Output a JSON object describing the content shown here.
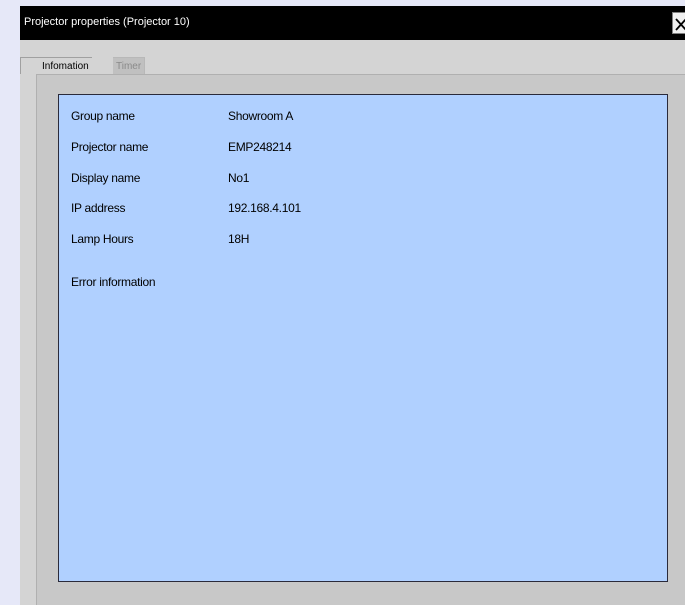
{
  "window": {
    "title": "Projector properties (Projector 10)"
  },
  "tabs": [
    {
      "label": "Infomation",
      "active": true
    },
    {
      "label": "Timer",
      "active": false
    }
  ],
  "info": {
    "rows": [
      {
        "label": "Group name",
        "value": "Showroom A"
      },
      {
        "label": "Projector name",
        "value": "EMP248214"
      },
      {
        "label": "Display name",
        "value": "No1"
      },
      {
        "label": "IP address",
        "value": "192.168.4.101"
      },
      {
        "label": "Lamp Hours",
        "value": "18H"
      }
    ],
    "error_label": "Error information"
  },
  "icons": {
    "close": "close-icon"
  },
  "colors": {
    "titlebar": "#000000",
    "panel_background": "#b0d0ff",
    "window_background": "#d4d4d4",
    "desktop_background": "#e6e8f8"
  }
}
